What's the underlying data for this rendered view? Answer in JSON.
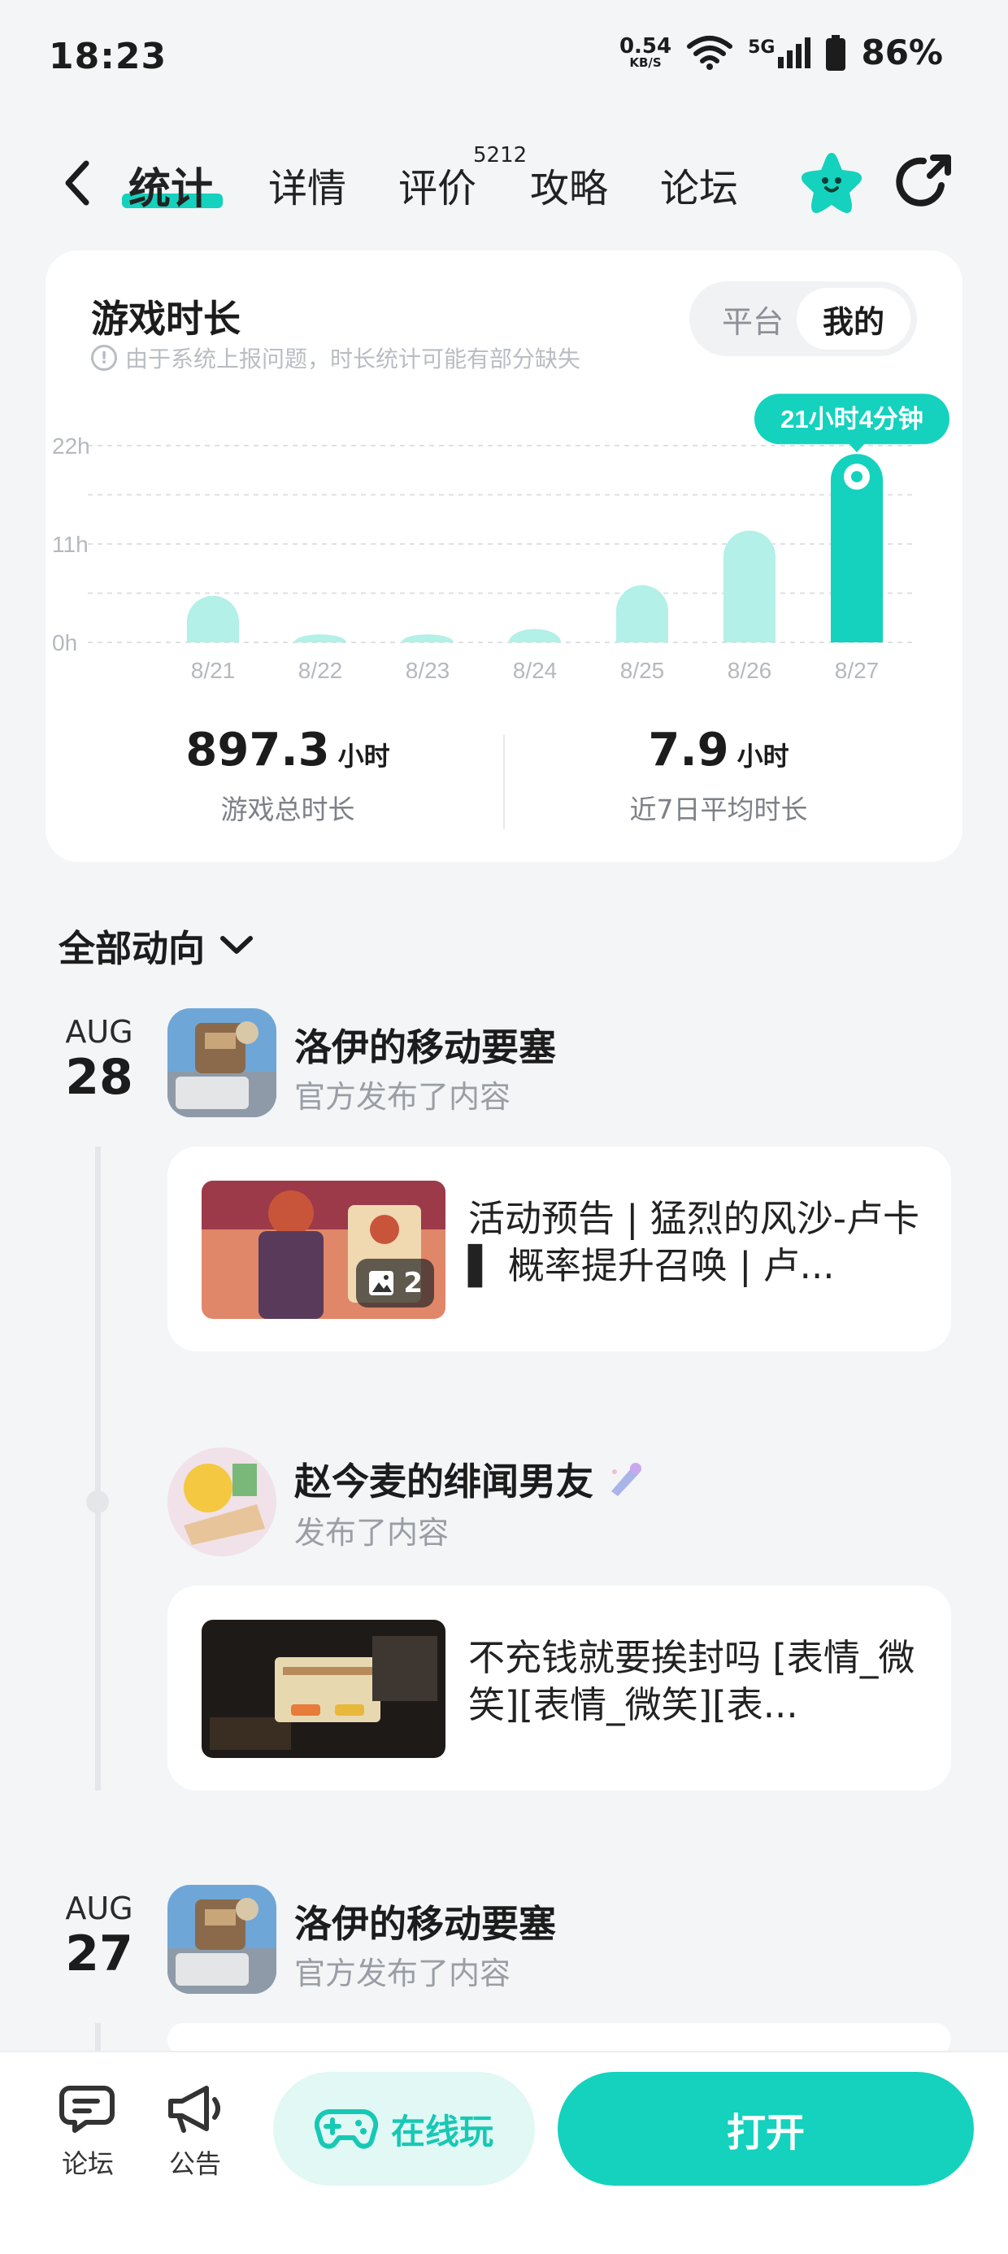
{
  "status_bar": {
    "time": "18:23",
    "net_speed": "0.54",
    "net_unit": "KB/S",
    "network": "5G",
    "battery": "86%"
  },
  "nav": {
    "tabs": [
      {
        "label": "统计",
        "active": true
      },
      {
        "label": "详情"
      },
      {
        "label": "评价",
        "badge": "5212"
      },
      {
        "label": "攻略"
      },
      {
        "label": "论坛"
      }
    ],
    "accent_color": "#14d2bd"
  },
  "stats": {
    "title": "游戏时长",
    "warning": "由于系统上报问题，时长统计可能有部分缺失",
    "toggle": [
      "平台",
      "我的"
    ],
    "toggle_selected": "我的",
    "highlight_label": "21小时4分钟",
    "total_value": "897.3",
    "total_unit": "小时",
    "total_label": "游戏总时长",
    "avg_value": "7.9",
    "avg_unit": "小时",
    "avg_label": "近7日平均时长"
  },
  "chart_data": {
    "type": "bar",
    "categories": [
      "8/21",
      "8/22",
      "8/23",
      "8/24",
      "8/25",
      "8/26",
      "8/27"
    ],
    "values": [
      5.2,
      0.9,
      0.9,
      1.5,
      6.4,
      12.5,
      21.07
    ],
    "y_ticks": [
      "22h",
      "11h",
      "0h"
    ],
    "ylim": [
      0,
      22
    ],
    "highlight_index": 6,
    "bar_color": "#b2f0e8",
    "highlight_color": "#14d2bd",
    "grid": true
  },
  "feed": {
    "filter_label": "全部动向",
    "groups": [
      {
        "month": "AUG",
        "day": "28",
        "posts": [
          {
            "author": "洛伊的移动要塞",
            "action": "官方发布了内容",
            "title": "活动预告 | 猛烈的风沙-卢卡 ▌ 概率提升召唤 | 卢...",
            "image_count": "2"
          },
          {
            "author": "赵今麦的绯闻男友",
            "action": "发布了内容",
            "title": "不充钱就要挨封吗 [表情_微笑][表情_微笑][表..."
          }
        ]
      },
      {
        "month": "AUG",
        "day": "27",
        "posts": [
          {
            "author": "洛伊的移动要塞",
            "action": "官方发布了内容"
          }
        ]
      }
    ]
  },
  "bottom_bar": {
    "forum": "论坛",
    "announce": "公告",
    "online_play": "在线玩",
    "open": "打开"
  }
}
